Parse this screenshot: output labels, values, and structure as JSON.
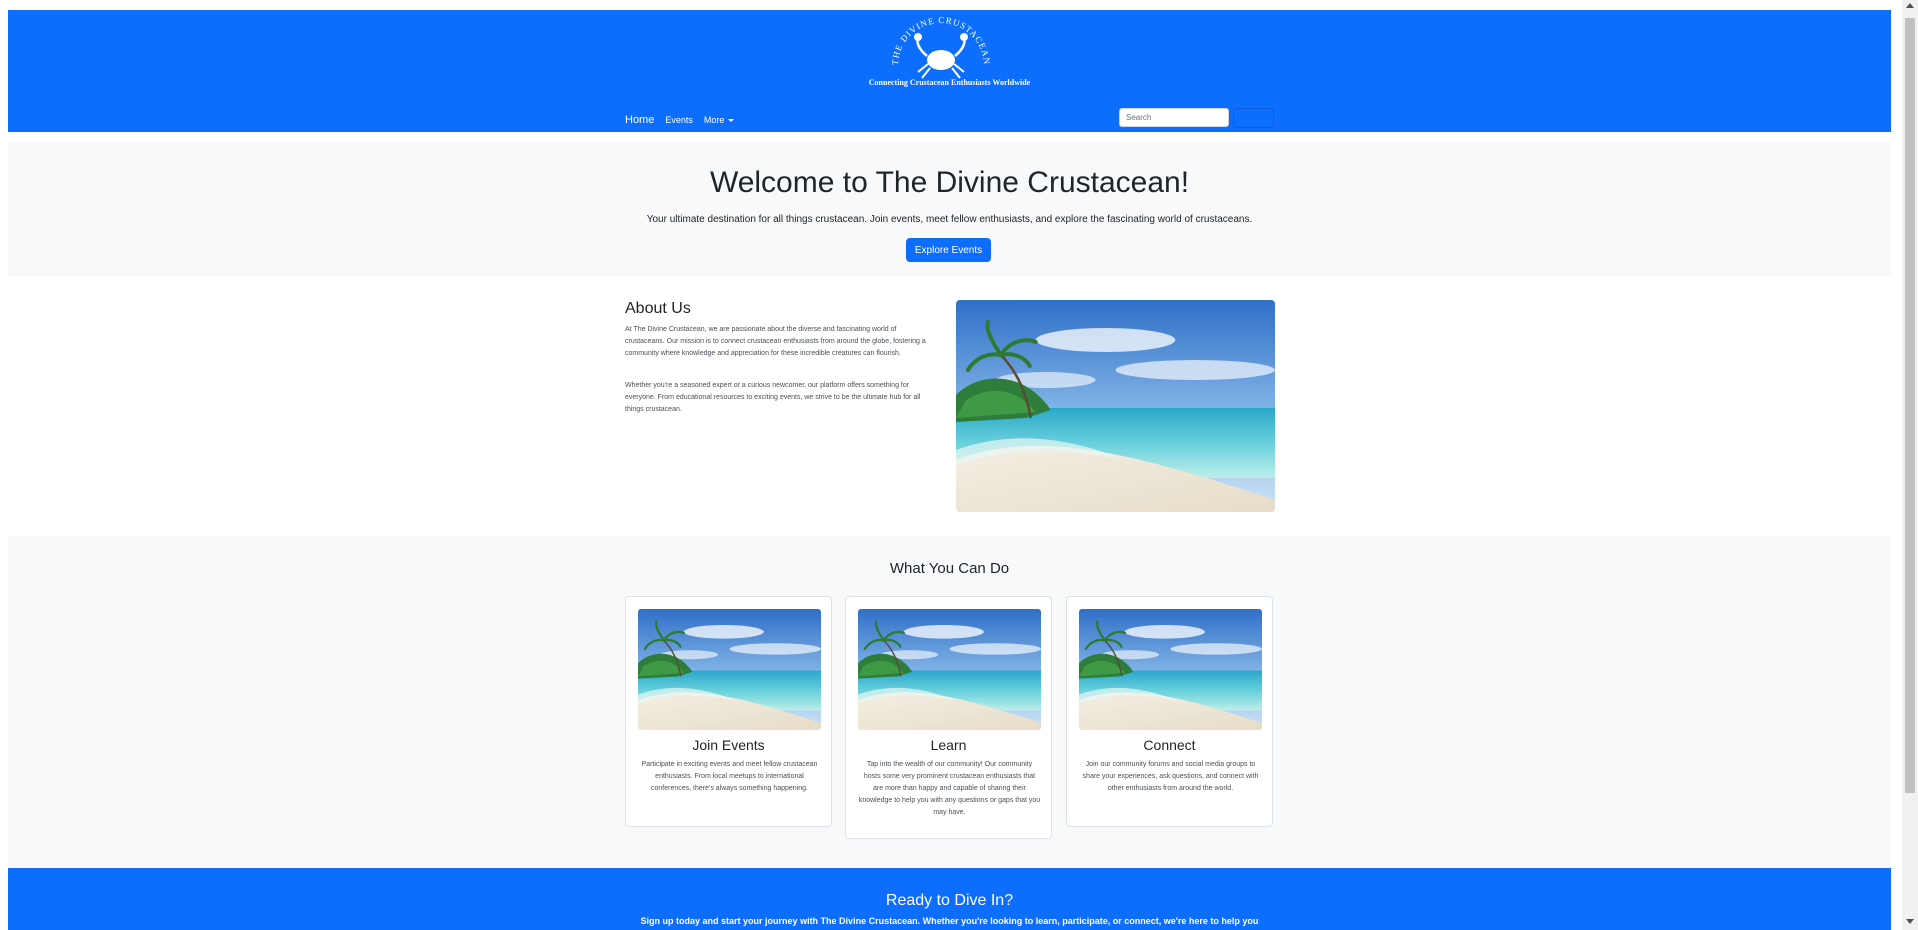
{
  "header": {
    "logo_text": "THE DIVINE CRUSTACEAN",
    "tagline": "Connecting Crustacean Enthusiasts Worldwide",
    "bg_color": "#0d6efd",
    "nav": {
      "home": "Home",
      "events": "Events",
      "more": "More"
    },
    "search": {
      "placeholder": "Search"
    }
  },
  "hero": {
    "title": "Welcome to The Divine Crustacean!",
    "subtitle": "Your ultimate destination for all things crustacean. Join events, meet fellow enthusiasts, and explore the fascinating world of crustaceans.",
    "button": "Explore Events"
  },
  "about": {
    "title": "About Us",
    "p1": "At The Divine Crustacean, we are passionate about the diverse and fascinating world of crustaceans. Our mission is to connect crustacean enthusiasts from around the globe, fostering a community where knowledge and appreciation for these incredible creatures can flourish.",
    "p2": "Whether you're a seasoned expert or a curious newcomer, our platform offers something for everyone. From educational resources to exciting events, we strive to be the ultimate hub for all things crustacean.",
    "image_icon": "beach-image"
  },
  "features": {
    "title": "What You Can Do",
    "cards": [
      {
        "title": "Join Events",
        "text": "Participate in exciting events and meet fellow crustacean enthusiasts. From local meetups to international conferences, there's always something happening."
      },
      {
        "title": "Learn",
        "text": "Tap into the wealth of our community! Our community hosts some very prominent crustacean enthusiasts that are more than happy and capable of sharing their knowledge to help you with any questions or gaps that you may have."
      },
      {
        "title": "Connect",
        "text": "Join our community forums and social media groups to share your experiences, ask questions, and connect with other enthusiasts from around the world."
      }
    ]
  },
  "cta": {
    "title": "Ready to Dive In?",
    "text": "Sign up today and start your journey with The Divine Crustacean. Whether you're looking to learn, participate, or connect, we're here to help you"
  }
}
